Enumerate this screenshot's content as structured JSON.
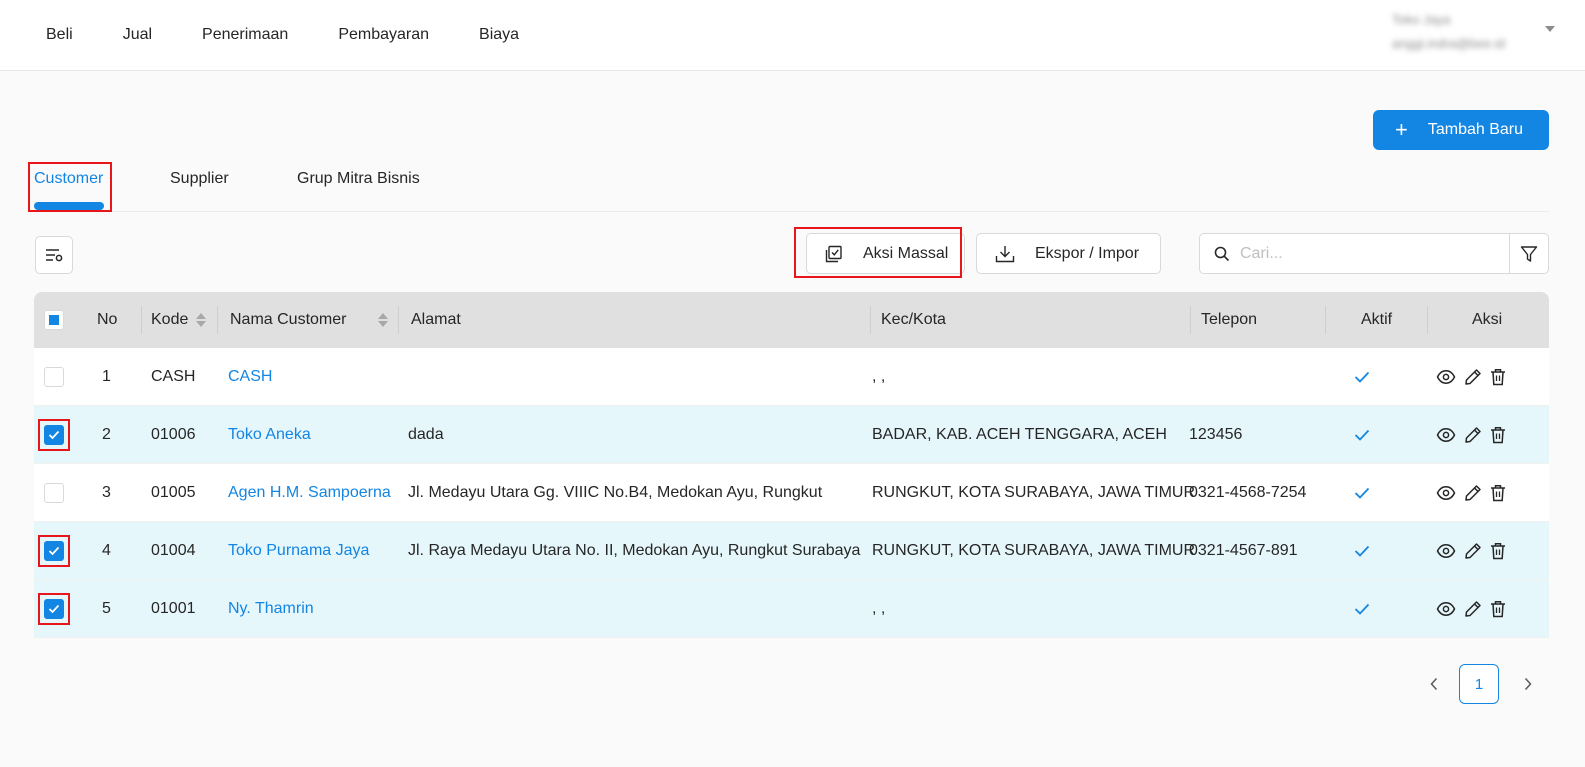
{
  "topnav": {
    "items": [
      "Beli",
      "Jual",
      "Penerimaan",
      "Pembayaran",
      "Biaya"
    ]
  },
  "user": {
    "name": "Toko Jaya",
    "email": "anggi.indra@bee.id"
  },
  "add_button": {
    "label": "Tambah Baru"
  },
  "tabs": [
    {
      "label": "Customer",
      "active": true
    },
    {
      "label": "Supplier",
      "active": false
    },
    {
      "label": "Grup Mitra Bisnis",
      "active": false
    }
  ],
  "toolbar": {
    "mass_action_label": "Aksi Massal",
    "export_import_label": "Ekspor / Impor",
    "search_placeholder": "Cari..."
  },
  "table": {
    "headers": {
      "no": "No",
      "kode": "Kode",
      "nama": "Nama Customer",
      "alamat": "Alamat",
      "kota": "Kec/Kota",
      "telepon": "Telepon",
      "aktif": "Aktif",
      "aksi": "Aksi"
    },
    "rows": [
      {
        "no": "1",
        "kode": "CASH",
        "nama": "CASH",
        "alamat": "",
        "kota": ", ,",
        "telepon": "",
        "aktif": true,
        "selected": false
      },
      {
        "no": "2",
        "kode": "01006",
        "nama": "Toko Aneka",
        "alamat": "dada",
        "kota": "BADAR, KAB. ACEH TENGGARA, ACEH",
        "telepon": "123456",
        "aktif": true,
        "selected": true
      },
      {
        "no": "3",
        "kode": "01005",
        "nama": "Agen H.M. Sampoerna",
        "alamat": "Jl. Medayu Utara Gg. VIIIC No.B4, Medokan Ayu, Rungkut",
        "kota": "RUNGKUT, KOTA SURABAYA, JAWA TIMUR",
        "telepon": "0321-4568-7254",
        "aktif": true,
        "selected": false
      },
      {
        "no": "4",
        "kode": "01004",
        "nama": "Toko Purnama Jaya",
        "alamat": "Jl. Raya Medayu Utara No. II, Medokan Ayu, Rungkut Surabaya",
        "kota": "RUNGKUT, KOTA SURABAYA, JAWA TIMUR",
        "telepon": "0321-4567-891",
        "aktif": true,
        "selected": true
      },
      {
        "no": "5",
        "kode": "01001",
        "nama": "Ny. Thamrin",
        "alamat": "",
        "kota": ", ,",
        "telepon": "",
        "aktif": true,
        "selected": true
      }
    ]
  },
  "pagination": {
    "current_page": "1"
  },
  "colors": {
    "accent": "#1385e2",
    "highlight": "#e8161b",
    "selected_row": "#e6f7fc",
    "header_bg": "#e0e0e0"
  },
  "icons": [
    "plus-icon",
    "column-settings-icon",
    "bulk-action-icon",
    "download-icon",
    "search-icon",
    "filter-icon",
    "check-icon",
    "eye-icon",
    "edit-icon",
    "trash-icon",
    "chevron-left-icon",
    "chevron-right-icon",
    "caret-down-icon"
  ]
}
